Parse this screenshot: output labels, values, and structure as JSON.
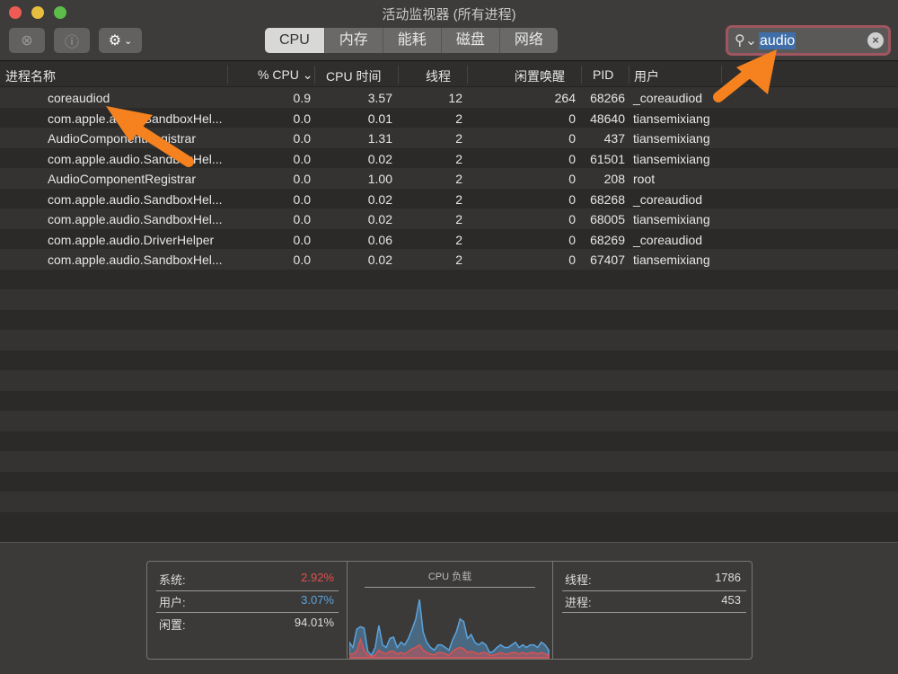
{
  "window": {
    "title": "活动监视器 (所有进程)"
  },
  "toolbar": {
    "tabs": [
      "CPU",
      "内存",
      "能耗",
      "磁盘",
      "网络"
    ],
    "active_tab": "CPU"
  },
  "search": {
    "value": "audio",
    "icon": "magnifier-icon"
  },
  "columns": [
    "进程名称",
    "% CPU",
    "CPU 时间",
    "线程",
    "闲置唤醒",
    "PID",
    "用户"
  ],
  "rows": [
    [
      "coreaudiod",
      "0.9",
      "3.57",
      "12",
      "264",
      "68266",
      "_coreaudiod"
    ],
    [
      "com.apple.audio.SandboxHel...",
      "0.0",
      "0.01",
      "2",
      "0",
      "48640",
      "tiansemixiang"
    ],
    [
      "AudioComponentRegistrar",
      "0.0",
      "1.31",
      "2",
      "0",
      "437",
      "tiansemixiang"
    ],
    [
      "com.apple.audio.SandboxHel...",
      "0.0",
      "0.02",
      "2",
      "0",
      "61501",
      "tiansemixiang"
    ],
    [
      "AudioComponentRegistrar",
      "0.0",
      "1.00",
      "2",
      "0",
      "208",
      "root"
    ],
    [
      "com.apple.audio.SandboxHel...",
      "0.0",
      "0.02",
      "2",
      "0",
      "68268",
      "_coreaudiod"
    ],
    [
      "com.apple.audio.SandboxHel...",
      "0.0",
      "0.02",
      "2",
      "0",
      "68005",
      "tiansemixiang"
    ],
    [
      "com.apple.audio.DriverHelper",
      "0.0",
      "0.06",
      "2",
      "0",
      "68269",
      "_coreaudiod"
    ],
    [
      "com.apple.audio.SandboxHel...",
      "0.0",
      "0.02",
      "2",
      "0",
      "67407",
      "tiansemixiang"
    ]
  ],
  "summary": {
    "system_label": "系统:",
    "system_value": "2.92%",
    "user_label": "用户:",
    "user_value": "3.07%",
    "idle_label": "闲置:",
    "idle_value": "94.01%",
    "graph_title": "CPU 负载",
    "threads_label": "线程:",
    "threads_value": "1786",
    "processes_label": "进程:",
    "processes_value": "453"
  },
  "cpu_load": {
    "total": [
      12,
      8,
      22,
      24,
      23,
      5,
      2,
      8,
      25,
      10,
      8,
      15,
      16,
      8,
      12,
      10,
      15,
      22,
      30,
      45,
      20,
      12,
      8,
      6,
      10,
      10,
      8,
      6,
      14,
      20,
      30,
      28,
      15,
      18,
      12,
      10,
      12,
      10,
      4,
      5,
      8,
      10,
      8,
      8,
      10,
      12,
      8,
      10,
      8,
      10,
      10,
      8,
      12,
      10,
      6
    ],
    "system": [
      3,
      3,
      5,
      14,
      6,
      2,
      1,
      2,
      6,
      4,
      3,
      5,
      5,
      3,
      4,
      3,
      5,
      7,
      8,
      10,
      6,
      4,
      3,
      2,
      4,
      4,
      3,
      2,
      5,
      7,
      8,
      7,
      4,
      5,
      4,
      3,
      4,
      4,
      2,
      2,
      3,
      4,
      3,
      3,
      4,
      4,
      3,
      4,
      3,
      4,
      4,
      3,
      4,
      3,
      2
    ]
  },
  "colors": {
    "system": "#e0504f",
    "user": "#5ba3dd",
    "annotation": "#f5821f"
  }
}
